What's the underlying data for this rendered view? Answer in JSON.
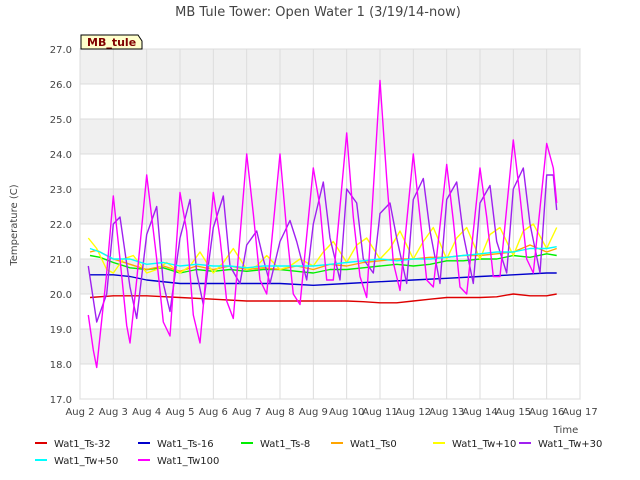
{
  "chart_data": {
    "type": "line",
    "title": "MB Tule Tower: Open Water 1 (3/19/14-now)",
    "xlabel": "Time",
    "ylabel": "Temperature (C)",
    "xlim": [
      2.0,
      17.0
    ],
    "ylim": [
      17.0,
      27.0
    ],
    "grid": true,
    "legend_position": "bottom",
    "station_label": "MB_tule",
    "xticks": [
      {
        "v": 2,
        "label": "Aug 2"
      },
      {
        "v": 3,
        "label": "Aug 3"
      },
      {
        "v": 4,
        "label": "Aug 4"
      },
      {
        "v": 5,
        "label": "Aug 5"
      },
      {
        "v": 6,
        "label": "Aug 6"
      },
      {
        "v": 7,
        "label": "Aug 7"
      },
      {
        "v": 8,
        "label": "Aug 8"
      },
      {
        "v": 9,
        "label": "Aug 9"
      },
      {
        "v": 10,
        "label": "Aug 10"
      },
      {
        "v": 11,
        "label": "Aug 11"
      },
      {
        "v": 12,
        "label": "Aug 12"
      },
      {
        "v": 13,
        "label": "Aug 13"
      },
      {
        "v": 14,
        "label": "Aug 14"
      },
      {
        "v": 15,
        "label": "Aug 15"
      },
      {
        "v": 16,
        "label": "Aug 16"
      },
      {
        "v": 17,
        "label": "Aug 17"
      }
    ],
    "yticks": [
      {
        "v": 17,
        "label": "17.0"
      },
      {
        "v": 18,
        "label": "18.0"
      },
      {
        "v": 19,
        "label": "19.0"
      },
      {
        "v": 20,
        "label": "20.0"
      },
      {
        "v": 21,
        "label": "21.0"
      },
      {
        "v": 22,
        "label": "22.0"
      },
      {
        "v": 23,
        "label": "23.0"
      },
      {
        "v": 24,
        "label": "24.0"
      },
      {
        "v": 25,
        "label": "25.0"
      },
      {
        "v": 26,
        "label": "26.0"
      },
      {
        "v": 27,
        "label": "27.0"
      }
    ],
    "series": [
      {
        "name": "Wat1_Ts-32",
        "color": "#dd0000",
        "x": [
          2.3,
          3.0,
          4.0,
          5.0,
          6.0,
          7.0,
          8.0,
          9.0,
          10.0,
          10.5,
          11.0,
          11.5,
          12.0,
          12.5,
          13.0,
          13.5,
          14.0,
          14.5,
          15.0,
          15.5,
          16.0,
          16.3
        ],
        "y": [
          19.9,
          19.95,
          19.95,
          19.9,
          19.85,
          19.8,
          19.8,
          19.8,
          19.8,
          19.78,
          19.75,
          19.75,
          19.8,
          19.85,
          19.9,
          19.9,
          19.9,
          19.92,
          20.0,
          19.95,
          19.95,
          20.0
        ]
      },
      {
        "name": "Wat1_Ts-16",
        "color": "#0000cc",
        "x": [
          2.3,
          3.0,
          3.5,
          4.0,
          5.0,
          6.0,
          7.0,
          8.0,
          9.0,
          10.0,
          11.0,
          12.0,
          13.0,
          14.0,
          15.0,
          16.0,
          16.3
        ],
        "y": [
          20.55,
          20.55,
          20.5,
          20.4,
          20.3,
          20.3,
          20.3,
          20.3,
          20.25,
          20.3,
          20.35,
          20.4,
          20.45,
          20.5,
          20.55,
          20.6,
          20.6
        ]
      },
      {
        "name": "Wat1_Ts-8",
        "color": "#00ee00",
        "x": [
          2.3,
          2.6,
          3.0,
          3.5,
          4.0,
          4.5,
          5.0,
          5.5,
          6.0,
          6.5,
          7.0,
          7.5,
          8.0,
          8.5,
          9.0,
          9.5,
          10.0,
          10.5,
          11.0,
          11.5,
          12.0,
          12.5,
          13.0,
          13.5,
          14.0,
          14.5,
          15.0,
          15.5,
          16.0,
          16.3
        ],
        "y": [
          21.1,
          21.05,
          20.9,
          20.75,
          20.7,
          20.75,
          20.6,
          20.7,
          20.65,
          20.7,
          20.65,
          20.7,
          20.7,
          20.65,
          20.6,
          20.7,
          20.7,
          20.75,
          20.8,
          20.85,
          20.8,
          20.85,
          20.95,
          20.95,
          21.0,
          21.0,
          21.1,
          21.05,
          21.15,
          21.1
        ]
      },
      {
        "name": "Wat1_Ts0",
        "color": "#ffa500",
        "x": [
          2.3,
          2.5,
          3.0,
          3.5,
          4.0,
          4.5,
          5.0,
          5.5,
          6.0,
          6.5,
          7.0,
          7.5,
          8.0,
          8.5,
          9.0,
          9.5,
          10.0,
          10.5,
          11.0,
          11.5,
          12.0,
          12.5,
          13.0,
          13.5,
          14.0,
          14.5,
          15.0,
          15.5,
          16.0,
          16.3
        ],
        "y": [
          21.2,
          21.25,
          21.0,
          20.85,
          20.7,
          20.8,
          20.65,
          20.8,
          20.7,
          20.8,
          20.7,
          20.75,
          20.7,
          20.8,
          20.7,
          20.85,
          20.8,
          20.9,
          20.95,
          21.0,
          21.0,
          21.05,
          21.05,
          21.1,
          21.1,
          21.15,
          21.2,
          21.4,
          21.2,
          21.3
        ]
      },
      {
        "name": "Wat1_Tw+10",
        "color": "#ffff00",
        "x": [
          2.25,
          2.5,
          2.8,
          3.0,
          3.3,
          3.6,
          4.0,
          4.3,
          4.6,
          5.0,
          5.3,
          5.6,
          6.0,
          6.3,
          6.6,
          7.0,
          7.3,
          7.6,
          8.0,
          8.3,
          8.6,
          9.0,
          9.3,
          9.6,
          10.0,
          10.3,
          10.6,
          11.0,
          11.3,
          11.6,
          12.0,
          12.3,
          12.6,
          13.0,
          13.3,
          13.6,
          14.0,
          14.3,
          14.6,
          15.0,
          15.3,
          15.6,
          16.0,
          16.3
        ],
        "y": [
          21.6,
          21.3,
          20.7,
          20.6,
          21.0,
          21.1,
          20.6,
          20.7,
          20.9,
          20.6,
          20.8,
          21.2,
          20.6,
          20.9,
          21.3,
          20.7,
          20.8,
          21.1,
          20.7,
          20.8,
          21.0,
          20.8,
          21.2,
          21.5,
          20.9,
          21.4,
          21.6,
          21.0,
          21.3,
          21.8,
          21.0,
          21.5,
          21.9,
          21.0,
          21.6,
          21.9,
          21.0,
          21.7,
          21.9,
          21.1,
          21.8,
          22.0,
          21.3,
          21.9
        ]
      },
      {
        "name": "Wat1_Tw+30",
        "color": "#a020f0",
        "x": [
          2.25,
          2.5,
          2.8,
          3.0,
          3.2,
          3.5,
          3.7,
          4.0,
          4.3,
          4.5,
          4.7,
          5.0,
          5.3,
          5.5,
          5.7,
          6.0,
          6.3,
          6.5,
          6.8,
          7.0,
          7.3,
          7.5,
          7.7,
          8.0,
          8.3,
          8.5,
          8.8,
          9.0,
          9.3,
          9.5,
          9.8,
          10.0,
          10.3,
          10.5,
          10.8,
          11.0,
          11.3,
          11.5,
          11.8,
          12.0,
          12.3,
          12.5,
          12.8,
          13.0,
          13.3,
          13.5,
          13.8,
          14.0,
          14.3,
          14.5,
          14.8,
          15.0,
          15.3,
          15.5,
          15.8,
          16.0,
          16.2,
          16.3
        ],
        "y": [
          20.8,
          19.2,
          20.0,
          22.0,
          22.2,
          20.2,
          19.3,
          21.7,
          22.5,
          20.3,
          19.5,
          21.6,
          22.7,
          20.6,
          19.7,
          21.9,
          22.8,
          20.8,
          20.3,
          21.4,
          21.8,
          21.0,
          20.3,
          21.5,
          22.1,
          21.5,
          20.4,
          22.0,
          23.2,
          21.6,
          20.4,
          23.0,
          22.6,
          21.0,
          20.6,
          22.3,
          22.6,
          21.6,
          20.3,
          22.7,
          23.3,
          21.8,
          20.3,
          22.7,
          23.2,
          21.7,
          20.3,
          22.6,
          23.1,
          21.5,
          20.6,
          23.0,
          23.6,
          22.0,
          20.6,
          23.4,
          23.4,
          22.4
        ]
      },
      {
        "name": "Wat1_Tw+50",
        "color": "#00ffff",
        "x": [
          2.3,
          2.6,
          3.0,
          3.5,
          4.0,
          4.5,
          5.0,
          5.5,
          6.0,
          6.5,
          7.0,
          7.5,
          8.0,
          8.5,
          9.0,
          9.5,
          10.0,
          10.5,
          11.0,
          11.5,
          12.0,
          12.5,
          13.0,
          13.5,
          14.0,
          14.5,
          15.0,
          15.5,
          16.0,
          16.3
        ],
        "y": [
          21.3,
          21.2,
          21.0,
          21.0,
          20.85,
          20.9,
          20.8,
          20.85,
          20.8,
          20.8,
          20.75,
          20.8,
          20.8,
          20.8,
          20.8,
          20.85,
          20.9,
          20.95,
          21.0,
          20.95,
          21.0,
          21.0,
          21.05,
          21.1,
          21.15,
          21.2,
          21.2,
          21.3,
          21.3,
          21.35
        ]
      },
      {
        "name": "Wat1_Tw100",
        "color": "#ff00ff",
        "x": [
          2.25,
          2.4,
          2.5,
          2.8,
          3.0,
          3.2,
          3.4,
          3.5,
          3.7,
          4.0,
          4.3,
          4.5,
          4.7,
          5.0,
          5.2,
          5.4,
          5.6,
          6.0,
          6.2,
          6.4,
          6.6,
          7.0,
          7.2,
          7.4,
          7.6,
          8.0,
          8.2,
          8.4,
          8.6,
          9.0,
          9.2,
          9.4,
          9.6,
          10.0,
          10.2,
          10.4,
          10.6,
          11.0,
          11.2,
          11.4,
          11.6,
          12.0,
          12.2,
          12.4,
          12.6,
          13.0,
          13.2,
          13.4,
          13.6,
          14.0,
          14.2,
          14.4,
          14.6,
          15.0,
          15.2,
          15.4,
          15.6,
          16.0,
          16.2,
          16.3
        ],
        "y": [
          19.4,
          18.4,
          17.9,
          20.6,
          22.8,
          21.0,
          19.1,
          18.6,
          20.4,
          23.4,
          21.0,
          19.2,
          18.8,
          22.9,
          21.8,
          19.4,
          18.6,
          22.9,
          21.6,
          19.8,
          19.3,
          24.0,
          22.3,
          20.4,
          20.0,
          24.0,
          21.8,
          20.0,
          19.7,
          23.6,
          22.5,
          20.4,
          20.4,
          24.6,
          22.2,
          20.5,
          19.9,
          26.1,
          23.3,
          20.9,
          20.1,
          24.0,
          22.2,
          20.4,
          20.2,
          23.7,
          22.1,
          20.2,
          20.0,
          23.6,
          22.2,
          20.5,
          20.5,
          24.4,
          22.8,
          21.0,
          20.6,
          24.3,
          23.6,
          22.6
        ]
      }
    ]
  }
}
